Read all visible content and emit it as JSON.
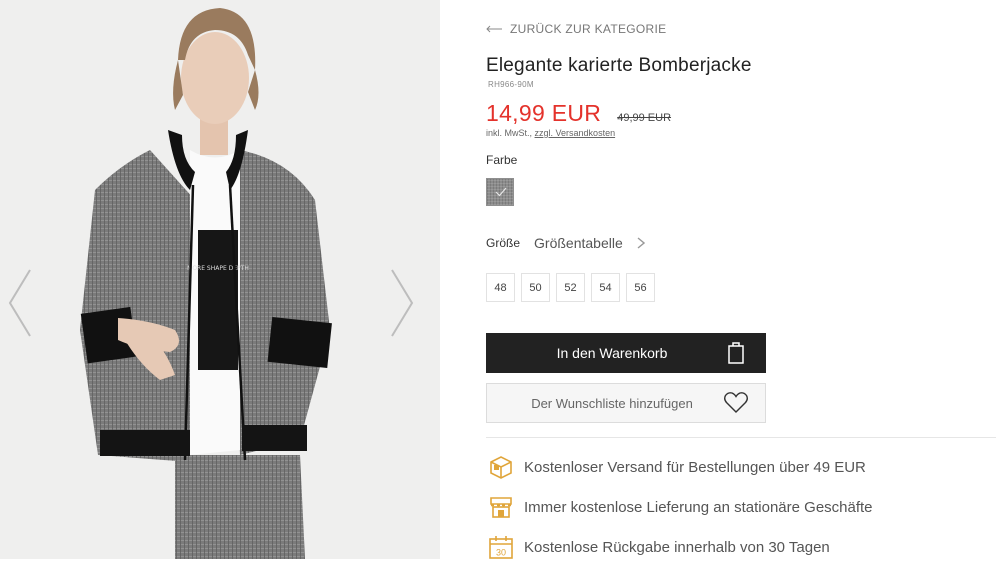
{
  "gallery": {
    "prev_icon": "chevron-left-icon",
    "next_icon": "chevron-right-icon",
    "image_alt": "model-wearing-checked-bomber-jacket",
    "shirt_print_text": "MORE SHAPE DEPTH"
  },
  "product": {
    "back_label": "ZURÜCK ZUR KATEGORIE",
    "title": "Elegante karierte Bomberjacke",
    "sku": "RH966-90M",
    "price_current": "14,99 EUR",
    "price_old": "49,99 EUR",
    "tax_prefix": "inkl. MwSt.,",
    "shipping_link": "zzgl. Versandkosten",
    "color_label": "Farbe",
    "size_label": "Größe",
    "size_table_label": "Größentabelle",
    "sizes": [
      "48",
      "50",
      "52",
      "54",
      "56"
    ],
    "cart_label": "In den Warenkorb",
    "wishlist_label": "Der Wunschliste hinzufügen",
    "colors": {
      "price": "#e4322b",
      "cart_bg": "#222222",
      "benefit_icon": "#e0a53a"
    }
  },
  "benefits": [
    {
      "icon": "delivery-box-icon",
      "text": "Kostenloser Versand für Bestellungen über 49 EUR"
    },
    {
      "icon": "store-icon",
      "text": "Immer kostenlose Lieferung an stationäre Geschäfte"
    },
    {
      "icon": "calendar-30-icon",
      "text": "Kostenlose Rückgabe innerhalb von 30 Tagen",
      "badge": "30"
    }
  ]
}
